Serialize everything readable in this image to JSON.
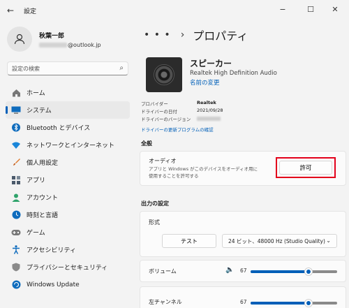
{
  "window": {
    "title": "設定",
    "back_glyph": "←",
    "minimize_glyph": "−",
    "maximize_glyph": "☐",
    "close_glyph": "✕"
  },
  "profile": {
    "name": "秋葉一郎",
    "email_domain": "@outlook.jp"
  },
  "search": {
    "placeholder": "設定の検索"
  },
  "sidebar": {
    "items": [
      {
        "label": "ホーム",
        "icon": "home-icon",
        "color": "#6b6b6b"
      },
      {
        "label": "システム",
        "icon": "system-icon",
        "color": "#0f6cbd"
      },
      {
        "label": "Bluetooth とデバイス",
        "icon": "bluetooth-icon",
        "color": "#0f6cbd"
      },
      {
        "label": "ネットワークとインターネット",
        "icon": "network-icon",
        "color": "#0f6cbd"
      },
      {
        "label": "個人用設定",
        "icon": "brush-icon",
        "color": "#e07a2e"
      },
      {
        "label": "アプリ",
        "icon": "apps-icon",
        "color": "#4b5a6b"
      },
      {
        "label": "アカウント",
        "icon": "account-icon",
        "color": "#2fa36b"
      },
      {
        "label": "時刻と言語",
        "icon": "time-language-icon",
        "color": "#0f6cbd"
      },
      {
        "label": "ゲーム",
        "icon": "game-icon",
        "color": "#6b6b6b"
      },
      {
        "label": "アクセシビリティ",
        "icon": "accessibility-icon",
        "color": "#0f6cbd"
      },
      {
        "label": "プライバシーとセキュリティ",
        "icon": "shield-icon",
        "color": "#6b6b6b"
      },
      {
        "label": "Windows Update",
        "icon": "windows-update-icon",
        "color": "#0f6cbd"
      }
    ],
    "active_index": 1
  },
  "breadcrumb": {
    "dots": "• • •",
    "separator": "›",
    "title": "プロパティ"
  },
  "device": {
    "name": "スピーカー",
    "driver": "Realtek High Definition Audio",
    "rename_label": "名前の変更",
    "properties": [
      {
        "key": "プロバイダー",
        "value": "Realtek"
      },
      {
        "key": "ドライバーの日付",
        "value": "2021/09/28"
      },
      {
        "key": "ドライバーのバージョン",
        "value": ""
      }
    ],
    "update_link": "ドライバーの更新プログラムの確認"
  },
  "general": {
    "heading": "全般",
    "audio_title": "オーディオ",
    "audio_description": "アプリと Windows がこのデバイスをオーディオ用に使用することを許可する",
    "allow_label": "許可"
  },
  "output": {
    "heading": "出力の設定",
    "format_label": "形式",
    "test_label": "テスト",
    "format_value": "24 ビット、48000 Hz (Studio Quality)",
    "volume_label": "ボリューム",
    "volume_value": "67",
    "left_channel_label": "左チャンネル",
    "left_channel_value": "67",
    "volume_level": 0.67,
    "left_channel_level": 0.67
  },
  "colors": {
    "accent": "#005fb8",
    "highlight_box": "#e3001b"
  }
}
